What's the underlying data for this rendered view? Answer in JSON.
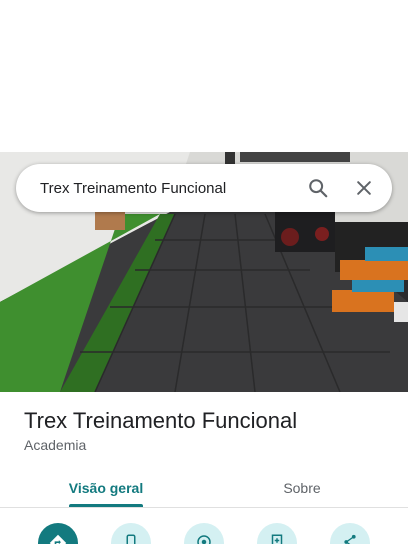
{
  "search": {
    "query": "Trex Treinamento Funcional",
    "search_icon": "search-icon",
    "close_icon": "close-icon"
  },
  "place": {
    "name": "Trex Treinamento Funcional",
    "category": "Academia"
  },
  "tabs": [
    {
      "label": "Visão geral",
      "selected": true
    },
    {
      "label": "Sobre",
      "selected": false
    }
  ],
  "actions": [
    {
      "icon": "directions-icon"
    },
    {
      "icon": "phone-icon"
    },
    {
      "icon": "nearby-icon"
    },
    {
      "icon": "save-icon"
    },
    {
      "icon": "share-icon"
    }
  ],
  "colors": {
    "accent": "#137a7f",
    "action_bg": "#d4f0f2",
    "turf": "#3f8f2f",
    "floor": "#3a3a3c"
  }
}
